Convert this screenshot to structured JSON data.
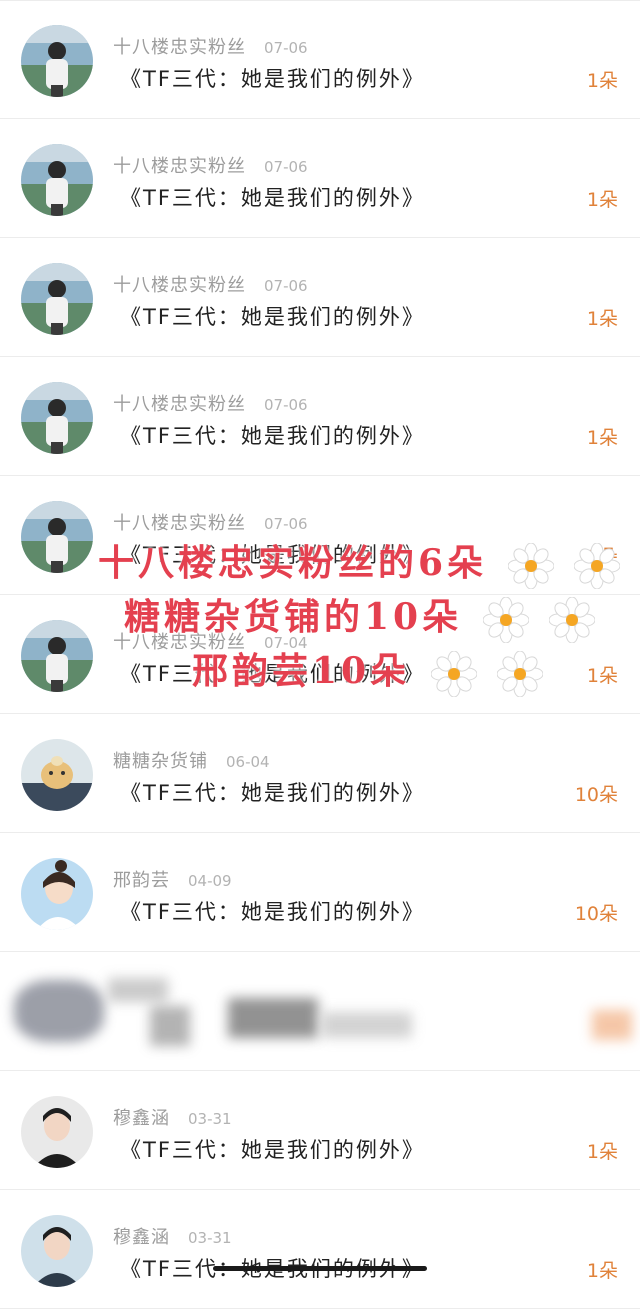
{
  "rows": [
    {
      "name": "十八楼忠实粉丝",
      "date": "07-06",
      "title": "《TF三代：她是我们的例外》",
      "count": "1朵",
      "avatar": "boy-photo-avatar"
    },
    {
      "name": "十八楼忠实粉丝",
      "date": "07-06",
      "title": "《TF三代：她是我们的例外》",
      "count": "1朵",
      "avatar": "boy-photo-avatar"
    },
    {
      "name": "十八楼忠实粉丝",
      "date": "07-06",
      "title": "《TF三代：她是我们的例外》",
      "count": "1朵",
      "avatar": "boy-photo-avatar"
    },
    {
      "name": "十八楼忠实粉丝",
      "date": "07-06",
      "title": "《TF三代：她是我们的例外》",
      "count": "1朵",
      "avatar": "boy-photo-avatar"
    },
    {
      "name": "十八楼忠实粉丝",
      "date": "07-06",
      "title": "《TF三代：她是我们的例外》",
      "count": "1朵",
      "avatar": "boy-photo-avatar"
    },
    {
      "name": "十八楼忠实粉丝",
      "date": "07-04",
      "title": "《TF三代：她是我们的例外》",
      "count": "1朵",
      "avatar": "boy-photo-avatar"
    },
    {
      "name": "糖糖杂货铺",
      "date": "06-04",
      "title": "《TF三代：她是我们的例外》",
      "count": "10朵",
      "avatar": "plush-toy-avatar"
    },
    {
      "name": "邢韵芸",
      "date": "04-09",
      "title": "《TF三代：她是我们的例外》",
      "count": "10朵",
      "avatar": "girl-portrait-avatar"
    },
    {
      "name": "",
      "date": "",
      "title": "",
      "count": "",
      "avatar": "censored"
    },
    {
      "name": "穆鑫涵",
      "date": "03-31",
      "title": "《TF三代：她是我们的例外》",
      "count": "1朵",
      "avatar": "boy-portrait-avatar"
    },
    {
      "name": "穆鑫涵",
      "date": "03-31",
      "title": "《TF三代：她是我们的例外》",
      "count": "1朵",
      "avatar": "boy-portrait-avatar"
    }
  ],
  "overlay": {
    "line1": "十八楼忠实粉丝的6朵",
    "line2": "糖糖杂货铺的10朵",
    "line3": "邢韵芸10朵"
  },
  "colors": {
    "overlay_text": "#e4404f",
    "count_text": "#e0823a",
    "name_text": "#9c9c9c",
    "title_text": "#222222"
  },
  "icons": [
    "daisy-icon"
  ]
}
